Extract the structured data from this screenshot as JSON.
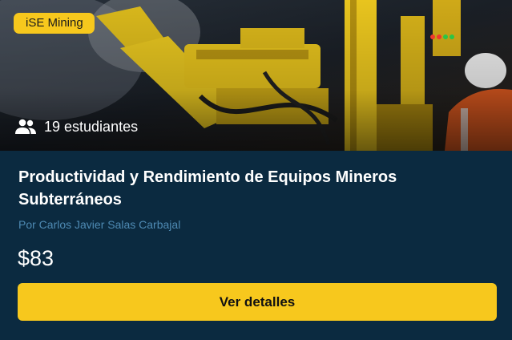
{
  "course": {
    "category_badge": "iSE Mining",
    "students_label": "19 estudiantes",
    "title": "Productividad y Rendimiento de Equipos Mineros Subterráneos",
    "author": "Por Carlos Javier Salas Carbajal",
    "price": "$83",
    "cta_label": "Ver detalles"
  },
  "icons": {
    "students": "users-icon"
  },
  "colors": {
    "accent": "#f7c81d",
    "card_background": "#0b2a40",
    "author_text": "#4e8ab3"
  }
}
